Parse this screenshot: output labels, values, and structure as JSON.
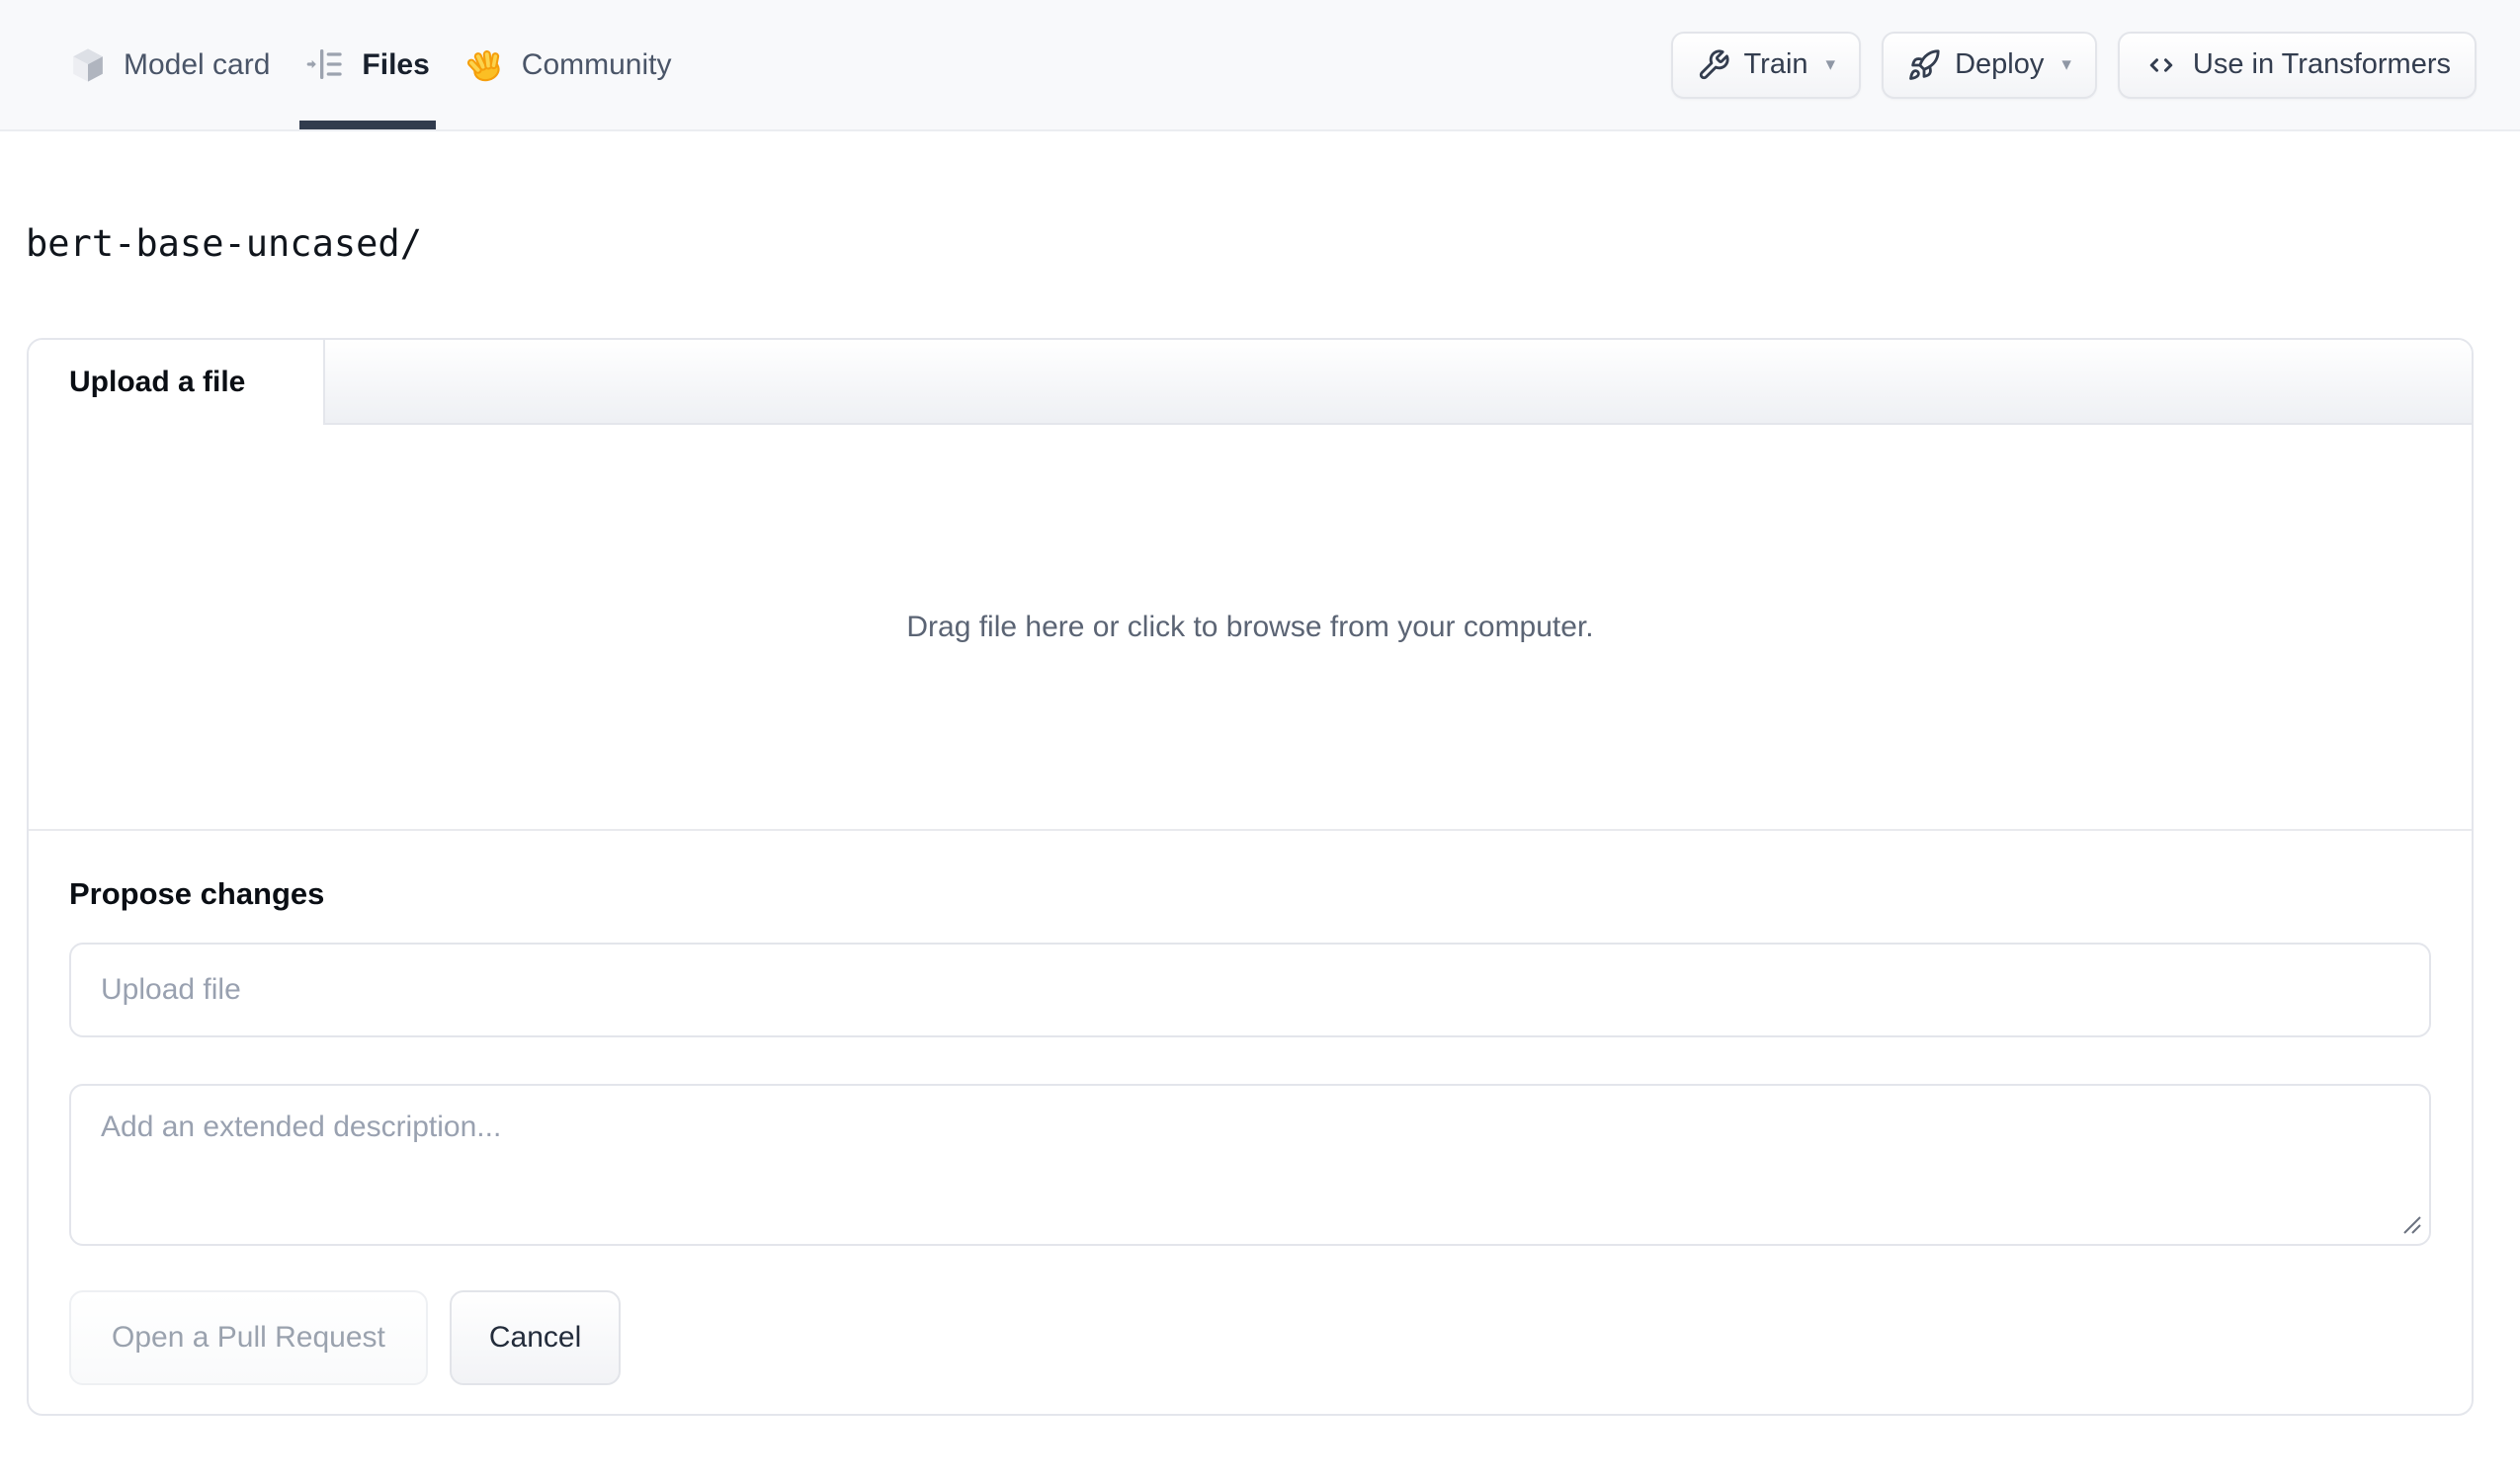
{
  "header": {
    "tabs": [
      {
        "label": "Model card",
        "icon": "cube-icon",
        "active": false
      },
      {
        "label": "Files",
        "icon": "file-versions-icon",
        "active": true
      },
      {
        "label": "Community",
        "icon": "waving-hand-icon",
        "active": false
      }
    ],
    "actions": [
      {
        "label": "Train",
        "icon": "wrench-icon",
        "has_dropdown": true,
        "caret": "▾"
      },
      {
        "label": "Deploy",
        "icon": "rocket-icon",
        "has_dropdown": true,
        "caret": "▾"
      },
      {
        "label": "Use in Transformers",
        "icon": "code-icon",
        "has_dropdown": false
      }
    ]
  },
  "breadcrumb": {
    "path": "bert-base-uncased/"
  },
  "upload_card": {
    "tab_label": "Upload a file",
    "dropzone_text": "Drag file here or click to browse from your computer.",
    "propose": {
      "heading": "Propose changes",
      "filename_placeholder": "Upload file",
      "description_placeholder": "Add an extended description...",
      "submit_label": "Open a Pull Request",
      "submit_enabled": false,
      "cancel_label": "Cancel"
    }
  },
  "colors": {
    "header_background": "#f8f9fb",
    "active_tab_underline": "#313c4e",
    "border": "#e4e6ec",
    "muted_text": "#5b6474",
    "placeholder_text": "#99a1b0",
    "emoji_hand": "#fbbf24"
  }
}
